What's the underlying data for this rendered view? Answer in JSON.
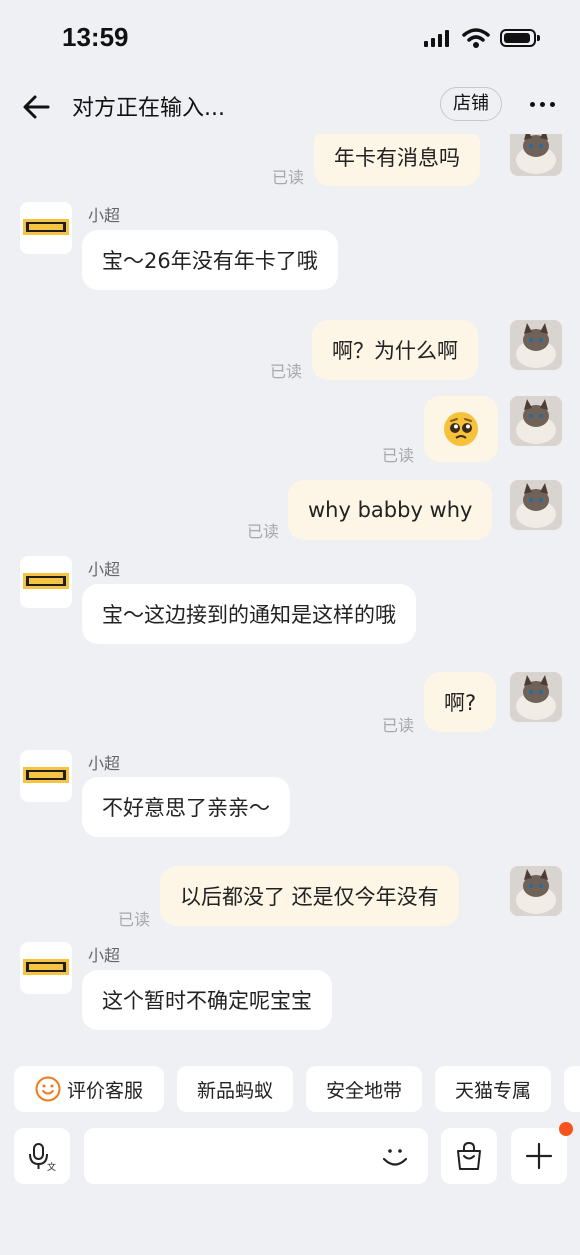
{
  "status_bar": {
    "time": "13:59"
  },
  "header": {
    "title": "对方正在输入...",
    "store_label": "店铺"
  },
  "sender_name": "小超",
  "read_label": "已读",
  "messages": [
    {
      "from": "me",
      "text": "年卡有消息吗",
      "read": true
    },
    {
      "from": "store",
      "sender": "小超",
      "text": "宝～26年没有年卡了哦"
    },
    {
      "from": "me",
      "text": "啊？为什么啊",
      "read": true
    },
    {
      "from": "me",
      "text": "🥺",
      "read": true
    },
    {
      "from": "me",
      "text": "why babby why",
      "read": true
    },
    {
      "from": "store",
      "sender": "小超",
      "text": "宝～这边接到的通知是这样的哦"
    },
    {
      "from": "me",
      "text": "啊?",
      "read": true
    },
    {
      "from": "store",
      "sender": "小超",
      "text": "不好意思了亲亲～"
    },
    {
      "from": "me",
      "text": "以后都没了 还是仅今年没有",
      "read": true
    },
    {
      "from": "store",
      "sender": "小超",
      "text": "这个暂时不确定呢宝宝"
    }
  ],
  "quick_replies": [
    "评价客服",
    "新品蚂蚁",
    "安全地带",
    "天猫专属"
  ],
  "icons": {
    "back": "arrow-left-icon",
    "more": "more-dots-icon",
    "rate": "smile-icon",
    "voice": "mic-translate-icon",
    "emoji": "smile-face-icon",
    "shop": "shopping-bag-icon",
    "add": "plus-icon"
  },
  "colors": {
    "background": "#eef0f4",
    "my_bubble": "#fdf6e6",
    "other_bubble": "#ffffff",
    "accent": "#f07a1f",
    "badge": "#f5541d"
  }
}
